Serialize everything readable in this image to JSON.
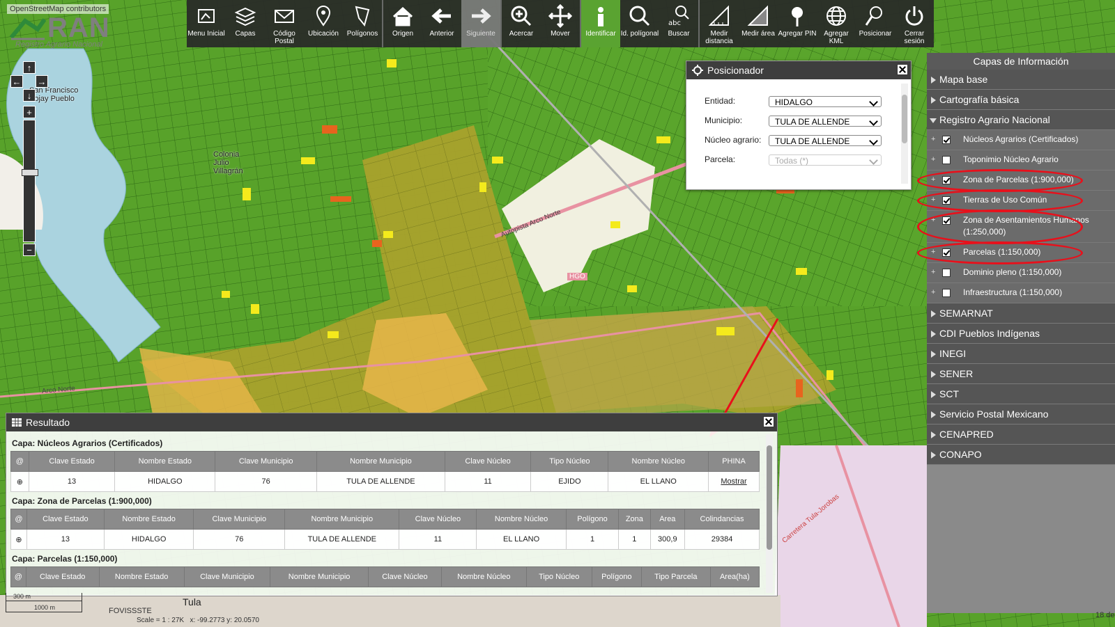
{
  "attribution": "OpenStreetMap contributors",
  "logo": {
    "text": "RAN",
    "subtitle": "Registro Agrario Nacional"
  },
  "map": {
    "labels": [
      "San Francisco Bojay Pueblo",
      "Colonia Julio Villagrán",
      "Tula",
      "Autopista Arco Norte",
      "Arco Norte",
      "Carretera Tula-Jorobas",
      "FOVISSSTE",
      "HGO"
    ],
    "colors": {
      "parcel_green": "#58a22a",
      "common_land": "#a9a530",
      "human_settlement": "#e8b64a",
      "water": "#aad3df",
      "highway": "#e892a2"
    }
  },
  "toolbar": [
    {
      "icon": "map-home-icon",
      "label": "Menu Inicial",
      "state": "normal"
    },
    {
      "icon": "layers-icon",
      "label": "Capas",
      "state": "normal"
    },
    {
      "icon": "envelope-icon",
      "label": "Código Postal",
      "state": "normal"
    },
    {
      "icon": "location-pin-icon",
      "label": "Ubicación",
      "state": "normal"
    },
    {
      "icon": "polygon-icon",
      "label": "Polígonos",
      "state": "normal"
    },
    {
      "icon": "home-icon",
      "label": "Origen",
      "state": "normal"
    },
    {
      "icon": "arrow-left-icon",
      "label": "Anterior",
      "state": "normal"
    },
    {
      "icon": "arrow-right-icon",
      "label": "Siguiente",
      "state": "disabled"
    },
    {
      "icon": "zoom-in-icon",
      "label": "Acercar",
      "state": "normal"
    },
    {
      "icon": "move-icon",
      "label": "Mover",
      "state": "normal"
    },
    {
      "icon": "info-icon",
      "label": "Identificar",
      "state": "active"
    },
    {
      "icon": "search-polygon-icon",
      "label": "Id. polígonal",
      "state": "normal"
    },
    {
      "icon": "search-abc-icon",
      "label": "Buscar",
      "state": "normal"
    },
    {
      "icon": "measure-distance-icon",
      "label": "Medir distancia",
      "state": "normal"
    },
    {
      "icon": "measure-area-icon",
      "label": "Medir área",
      "state": "normal"
    },
    {
      "icon": "pin-icon",
      "label": "Agregar PIN",
      "state": "normal"
    },
    {
      "icon": "globe-icon",
      "label": "Agregar KML",
      "state": "normal"
    },
    {
      "icon": "locate-icon",
      "label": "Posicionar",
      "state": "normal"
    },
    {
      "icon": "power-icon",
      "label": "Cerrar sesión",
      "state": "normal"
    }
  ],
  "positioner": {
    "title": "Posicionador",
    "fields": [
      {
        "label": "Entidad:",
        "value": "HIDALGO",
        "disabled": false
      },
      {
        "label": "Municipio:",
        "value": "TULA DE ALLENDE",
        "disabled": false
      },
      {
        "label": "Núcleo agrario:",
        "value": "TULA DE ALLENDE",
        "disabled": false
      },
      {
        "label": "Parcela:",
        "value": "Todas (*)",
        "disabled": true
      }
    ]
  },
  "layers": {
    "title": "Capas de Información",
    "groups_top": [
      "Mapa base",
      "Cartografía básica"
    ],
    "open_group": "Registro Agrario Nacional",
    "sub_items": [
      {
        "label": "Núcleos Agrarios (Certificados)",
        "checked": true,
        "highlight": false
      },
      {
        "label": "Toponimio Núcleo Agrario",
        "checked": false,
        "highlight": false
      },
      {
        "label": "Zona de Parcelas (1:900,000)",
        "checked": true,
        "highlight": true
      },
      {
        "label": "Tierras de Uso Común",
        "checked": true,
        "highlight": true
      },
      {
        "label": "Zona de Asentamientos Humanos (1:250,000)",
        "checked": true,
        "highlight": true
      },
      {
        "label": "Parcelas (1:150,000)",
        "checked": true,
        "highlight": true
      },
      {
        "label": "Dominio pleno (1:150,000)",
        "checked": false,
        "highlight": false
      },
      {
        "label": "Infraestructura (1:150,000)",
        "checked": false,
        "highlight": false
      }
    ],
    "groups_bottom": [
      "SEMARNAT",
      "CDI Pueblos Indígenas",
      "INEGI",
      "SENER",
      "SCT",
      "Servicio Postal Mexicano",
      "CENAPRED",
      "CONAPO"
    ],
    "highlight_color": "#e8101b"
  },
  "results": {
    "title": "Resultado",
    "tables": [
      {
        "caption": "Capa: Núcleos Agrarios (Certificados)",
        "headers": [
          "@",
          "Clave Estado",
          "Nombre Estado",
          "Clave Municipio",
          "Nombre Municipio",
          "Clave Núcleo",
          "Tipo Núcleo",
          "Nombre Núcleo",
          "PHINA"
        ],
        "rows": [
          [
            "⊕",
            "13",
            "HIDALGO",
            "76",
            "TULA DE ALLENDE",
            "11",
            "EJIDO",
            "EL LLANO",
            "Mostrar"
          ]
        ]
      },
      {
        "caption": "Capa: Zona de Parcelas (1:900,000)",
        "headers": [
          "@",
          "Clave Estado",
          "Nombre Estado",
          "Clave Municipio",
          "Nombre Municipio",
          "Clave Núcleo",
          "Nombre Núcleo",
          "Polígono",
          "Zona",
          "Area",
          "Colindancias"
        ],
        "rows": [
          [
            "⊕",
            "13",
            "HIDALGO",
            "76",
            "TULA DE ALLENDE",
            "11",
            "EL LLANO",
            "1",
            "1",
            "300,9",
            "29384"
          ]
        ]
      },
      {
        "caption": "Capa: Parcelas (1:150,000)",
        "headers": [
          "@",
          "Clave Estado",
          "Nombre Estado",
          "Clave Municipio",
          "Nombre Municipio",
          "Clave Núcleo",
          "Nombre Núcleo",
          "Tipo Núcleo",
          "Polígono",
          "Tipo Parcela",
          "Area(ha)"
        ],
        "rows": []
      }
    ]
  },
  "status": {
    "scale_bar_top": "300 m",
    "scale_bar_bottom": "1000 m",
    "scale": "Scale = 1 : 27K",
    "coords": "x: -99.2773  y: 20.0570",
    "date_fragment": "18 de"
  }
}
